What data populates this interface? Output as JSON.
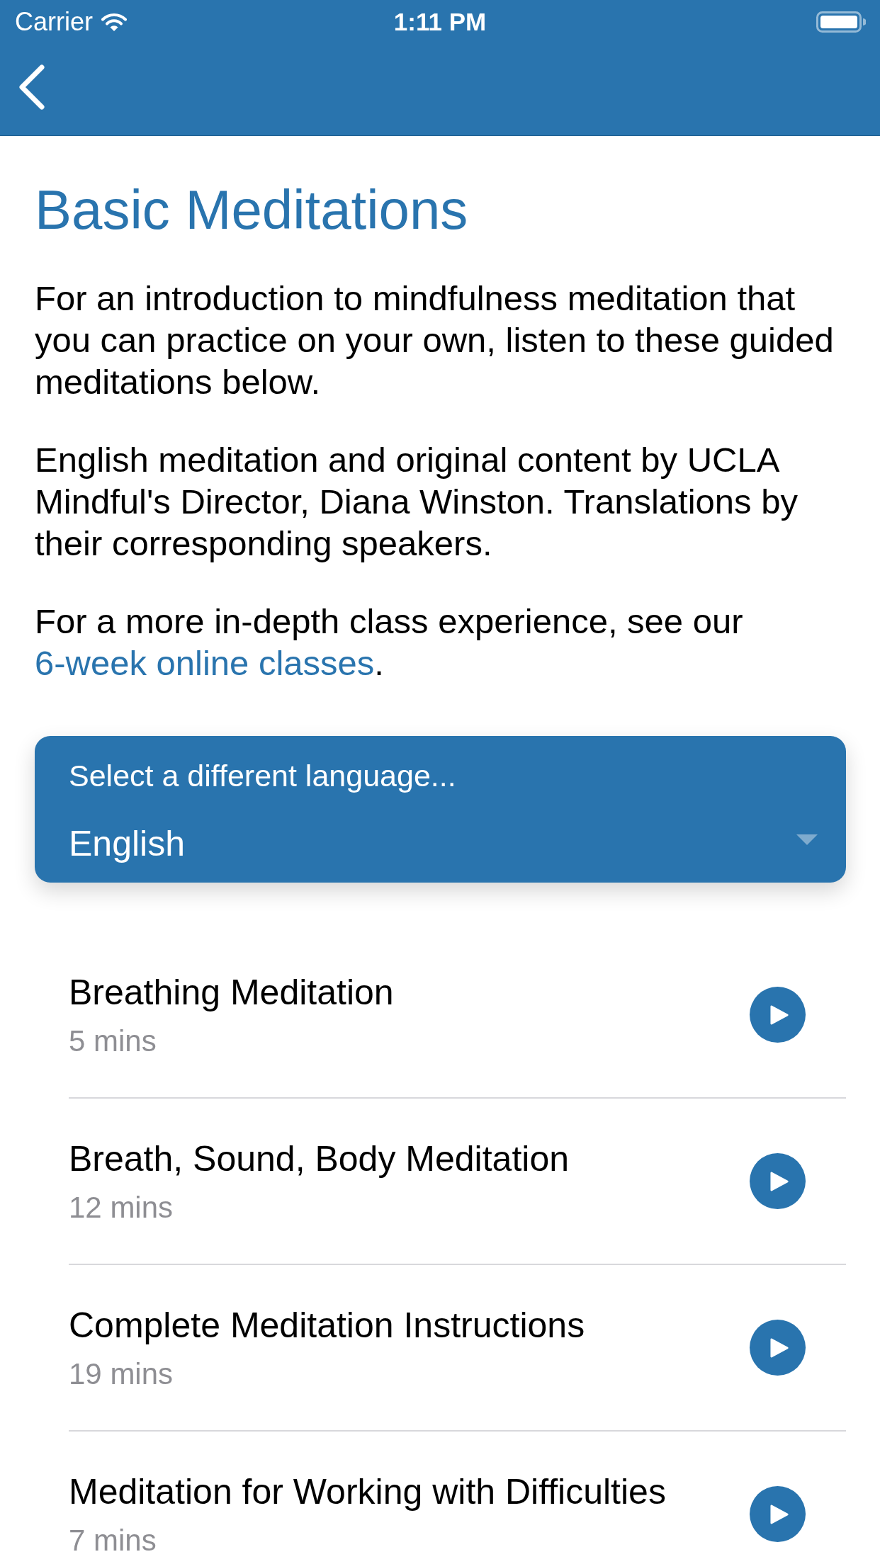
{
  "status_bar": {
    "carrier": "Carrier",
    "time": "1:11 PM"
  },
  "page": {
    "title": "Basic Meditations",
    "paragraphs": [
      [
        {
          "kind": "text",
          "text": "For an introduction to mindfulness meditation that you can practice on your own, listen to these guided meditations below."
        }
      ],
      [
        {
          "kind": "text",
          "text": "English meditation and original content by UCLA Mindful's Director, Diana Winston. Translations by their corresponding speakers."
        }
      ],
      [
        {
          "kind": "text",
          "text": "For a more in-depth class experience, see our "
        },
        {
          "kind": "link",
          "text": "6-week online classes"
        },
        {
          "kind": "text",
          "text": "."
        }
      ]
    ]
  },
  "language_select": {
    "label": "Select a different language...",
    "value": "English"
  },
  "meditations": [
    {
      "title": "Breathing Meditation",
      "duration": "5 mins"
    },
    {
      "title": "Breath, Sound, Body Meditation",
      "duration": "12 mins"
    },
    {
      "title": "Complete Meditation Instructions",
      "duration": "19 mins"
    },
    {
      "title": "Meditation for Working with Difficulties",
      "duration": "7 mins"
    }
  ]
}
